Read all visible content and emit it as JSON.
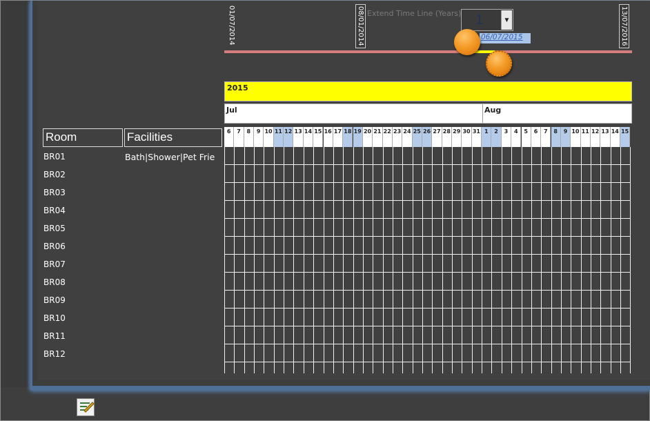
{
  "timeline": {
    "start_date": "01/07/2014",
    "mid_date": "08/01/2014",
    "end_date": "13/07/2016",
    "current_date": "06/07/2015",
    "extend_label": "Extend Time Line (Years)",
    "extend_value": "1",
    "colors": {
      "track": "#d67e7e",
      "selection": "#ffff00",
      "knob": "#f39a25"
    }
  },
  "calendar": {
    "year": "2015",
    "months": [
      {
        "label": "Jul"
      },
      {
        "label": "Aug"
      }
    ],
    "days": [
      {
        "d": "6",
        "w": false
      },
      {
        "d": "7",
        "w": false
      },
      {
        "d": "8",
        "w": false
      },
      {
        "d": "9",
        "w": false
      },
      {
        "d": "10",
        "w": false
      },
      {
        "d": "11",
        "w": true
      },
      {
        "d": "12",
        "w": true
      },
      {
        "d": "13",
        "w": false
      },
      {
        "d": "14",
        "w": false
      },
      {
        "d": "15",
        "w": false
      },
      {
        "d": "16",
        "w": false
      },
      {
        "d": "17",
        "w": false
      },
      {
        "d": "18",
        "w": true
      },
      {
        "d": "19",
        "w": true
      },
      {
        "d": "20",
        "w": false
      },
      {
        "d": "21",
        "w": false
      },
      {
        "d": "22",
        "w": false
      },
      {
        "d": "23",
        "w": false
      },
      {
        "d": "24",
        "w": false
      },
      {
        "d": "25",
        "w": true
      },
      {
        "d": "26",
        "w": true
      },
      {
        "d": "27",
        "w": false
      },
      {
        "d": "28",
        "w": false
      },
      {
        "d": "29",
        "w": false
      },
      {
        "d": "30",
        "w": false
      },
      {
        "d": "31",
        "w": false
      },
      {
        "d": "1",
        "w": true
      },
      {
        "d": "2",
        "w": true
      },
      {
        "d": "3",
        "w": false
      },
      {
        "d": "4",
        "w": false
      },
      {
        "d": "5",
        "w": false
      },
      {
        "d": "6",
        "w": false
      },
      {
        "d": "7",
        "w": false
      },
      {
        "d": "8",
        "w": true
      },
      {
        "d": "9",
        "w": true
      },
      {
        "d": "10",
        "w": false
      },
      {
        "d": "11",
        "w": false
      },
      {
        "d": "12",
        "w": false
      },
      {
        "d": "13",
        "w": false
      },
      {
        "d": "14",
        "w": false
      },
      {
        "d": "15",
        "w": true
      }
    ],
    "colors": {
      "weekend": "#b4ccea",
      "weekday": "#ffffff",
      "year_band": "#ffff00"
    }
  },
  "table": {
    "headers": {
      "room": "Room",
      "facilities": "Facilities"
    },
    "rows": [
      {
        "room": "BR01",
        "facilities": "Bath|Shower|Pet Frie"
      },
      {
        "room": "BR02",
        "facilities": ""
      },
      {
        "room": "BR03",
        "facilities": ""
      },
      {
        "room": "BR04",
        "facilities": ""
      },
      {
        "room": "BR05",
        "facilities": ""
      },
      {
        "room": "BR06",
        "facilities": ""
      },
      {
        "room": "BR07",
        "facilities": ""
      },
      {
        "room": "BR08",
        "facilities": ""
      },
      {
        "room": "BR09",
        "facilities": ""
      },
      {
        "room": "BR10",
        "facilities": ""
      },
      {
        "room": "BR11",
        "facilities": ""
      },
      {
        "room": "BR12",
        "facilities": ""
      }
    ]
  },
  "footer": {
    "icon": "edit-form-icon"
  }
}
